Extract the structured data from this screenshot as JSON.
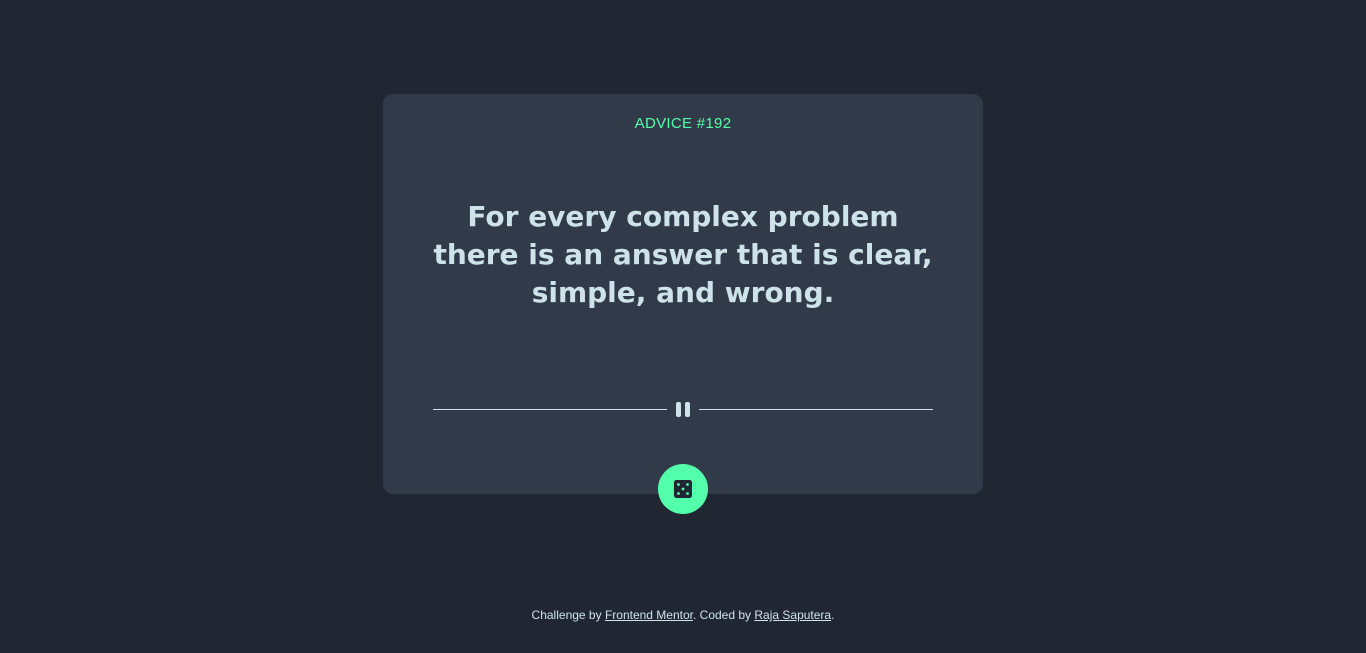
{
  "card": {
    "advice_id": "ADVICE #192",
    "advice_text": "For every complex problem there is an answer that is clear, simple, and wrong."
  },
  "divider": {
    "icon": "pause-icon"
  },
  "dice_button": {
    "icon": "dice-icon"
  },
  "footer": {
    "prefix": "Challenge by ",
    "link1": "Frontend Mentor",
    "middle": ". Coded by ",
    "link2": "Raja Saputera",
    "suffix": "."
  },
  "colors": {
    "background": "#202632",
    "card": "#313a49",
    "accent": "#53ffaa",
    "text": "#cee3e9"
  }
}
